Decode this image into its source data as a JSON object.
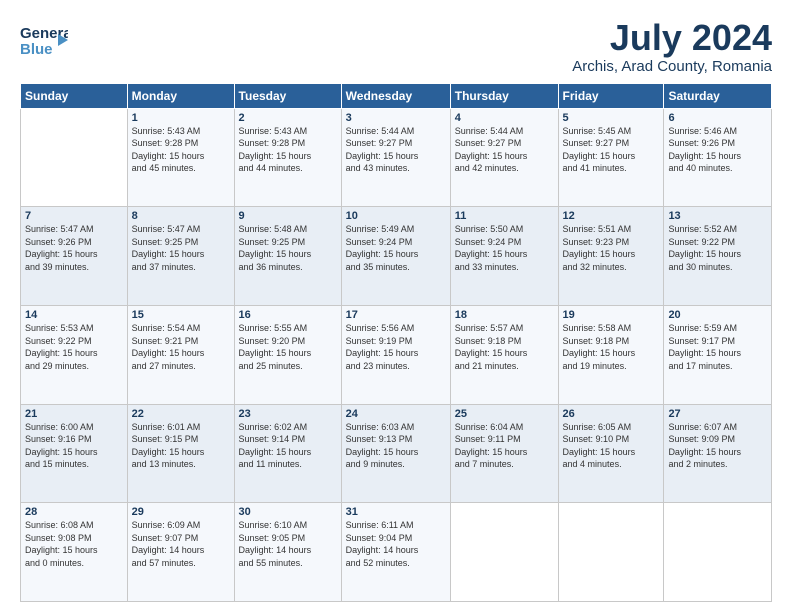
{
  "header": {
    "logo_general": "General",
    "logo_blue": "Blue",
    "month": "July 2024",
    "location": "Archis, Arad County, Romania"
  },
  "days_of_week": [
    "Sunday",
    "Monday",
    "Tuesday",
    "Wednesday",
    "Thursday",
    "Friday",
    "Saturday"
  ],
  "weeks": [
    [
      {
        "day": "",
        "info": ""
      },
      {
        "day": "1",
        "info": "Sunrise: 5:43 AM\nSunset: 9:28 PM\nDaylight: 15 hours\nand 45 minutes."
      },
      {
        "day": "2",
        "info": "Sunrise: 5:43 AM\nSunset: 9:28 PM\nDaylight: 15 hours\nand 44 minutes."
      },
      {
        "day": "3",
        "info": "Sunrise: 5:44 AM\nSunset: 9:27 PM\nDaylight: 15 hours\nand 43 minutes."
      },
      {
        "day": "4",
        "info": "Sunrise: 5:44 AM\nSunset: 9:27 PM\nDaylight: 15 hours\nand 42 minutes."
      },
      {
        "day": "5",
        "info": "Sunrise: 5:45 AM\nSunset: 9:27 PM\nDaylight: 15 hours\nand 41 minutes."
      },
      {
        "day": "6",
        "info": "Sunrise: 5:46 AM\nSunset: 9:26 PM\nDaylight: 15 hours\nand 40 minutes."
      }
    ],
    [
      {
        "day": "7",
        "info": "Sunrise: 5:47 AM\nSunset: 9:26 PM\nDaylight: 15 hours\nand 39 minutes."
      },
      {
        "day": "8",
        "info": "Sunrise: 5:47 AM\nSunset: 9:25 PM\nDaylight: 15 hours\nand 37 minutes."
      },
      {
        "day": "9",
        "info": "Sunrise: 5:48 AM\nSunset: 9:25 PM\nDaylight: 15 hours\nand 36 minutes."
      },
      {
        "day": "10",
        "info": "Sunrise: 5:49 AM\nSunset: 9:24 PM\nDaylight: 15 hours\nand 35 minutes."
      },
      {
        "day": "11",
        "info": "Sunrise: 5:50 AM\nSunset: 9:24 PM\nDaylight: 15 hours\nand 33 minutes."
      },
      {
        "day": "12",
        "info": "Sunrise: 5:51 AM\nSunset: 9:23 PM\nDaylight: 15 hours\nand 32 minutes."
      },
      {
        "day": "13",
        "info": "Sunrise: 5:52 AM\nSunset: 9:22 PM\nDaylight: 15 hours\nand 30 minutes."
      }
    ],
    [
      {
        "day": "14",
        "info": "Sunrise: 5:53 AM\nSunset: 9:22 PM\nDaylight: 15 hours\nand 29 minutes."
      },
      {
        "day": "15",
        "info": "Sunrise: 5:54 AM\nSunset: 9:21 PM\nDaylight: 15 hours\nand 27 minutes."
      },
      {
        "day": "16",
        "info": "Sunrise: 5:55 AM\nSunset: 9:20 PM\nDaylight: 15 hours\nand 25 minutes."
      },
      {
        "day": "17",
        "info": "Sunrise: 5:56 AM\nSunset: 9:19 PM\nDaylight: 15 hours\nand 23 minutes."
      },
      {
        "day": "18",
        "info": "Sunrise: 5:57 AM\nSunset: 9:18 PM\nDaylight: 15 hours\nand 21 minutes."
      },
      {
        "day": "19",
        "info": "Sunrise: 5:58 AM\nSunset: 9:18 PM\nDaylight: 15 hours\nand 19 minutes."
      },
      {
        "day": "20",
        "info": "Sunrise: 5:59 AM\nSunset: 9:17 PM\nDaylight: 15 hours\nand 17 minutes."
      }
    ],
    [
      {
        "day": "21",
        "info": "Sunrise: 6:00 AM\nSunset: 9:16 PM\nDaylight: 15 hours\nand 15 minutes."
      },
      {
        "day": "22",
        "info": "Sunrise: 6:01 AM\nSunset: 9:15 PM\nDaylight: 15 hours\nand 13 minutes."
      },
      {
        "day": "23",
        "info": "Sunrise: 6:02 AM\nSunset: 9:14 PM\nDaylight: 15 hours\nand 11 minutes."
      },
      {
        "day": "24",
        "info": "Sunrise: 6:03 AM\nSunset: 9:13 PM\nDaylight: 15 hours\nand 9 minutes."
      },
      {
        "day": "25",
        "info": "Sunrise: 6:04 AM\nSunset: 9:11 PM\nDaylight: 15 hours\nand 7 minutes."
      },
      {
        "day": "26",
        "info": "Sunrise: 6:05 AM\nSunset: 9:10 PM\nDaylight: 15 hours\nand 4 minutes."
      },
      {
        "day": "27",
        "info": "Sunrise: 6:07 AM\nSunset: 9:09 PM\nDaylight: 15 hours\nand 2 minutes."
      }
    ],
    [
      {
        "day": "28",
        "info": "Sunrise: 6:08 AM\nSunset: 9:08 PM\nDaylight: 15 hours\nand 0 minutes."
      },
      {
        "day": "29",
        "info": "Sunrise: 6:09 AM\nSunset: 9:07 PM\nDaylight: 14 hours\nand 57 minutes."
      },
      {
        "day": "30",
        "info": "Sunrise: 6:10 AM\nSunset: 9:05 PM\nDaylight: 14 hours\nand 55 minutes."
      },
      {
        "day": "31",
        "info": "Sunrise: 6:11 AM\nSunset: 9:04 PM\nDaylight: 14 hours\nand 52 minutes."
      },
      {
        "day": "",
        "info": ""
      },
      {
        "day": "",
        "info": ""
      },
      {
        "day": "",
        "info": ""
      }
    ]
  ]
}
